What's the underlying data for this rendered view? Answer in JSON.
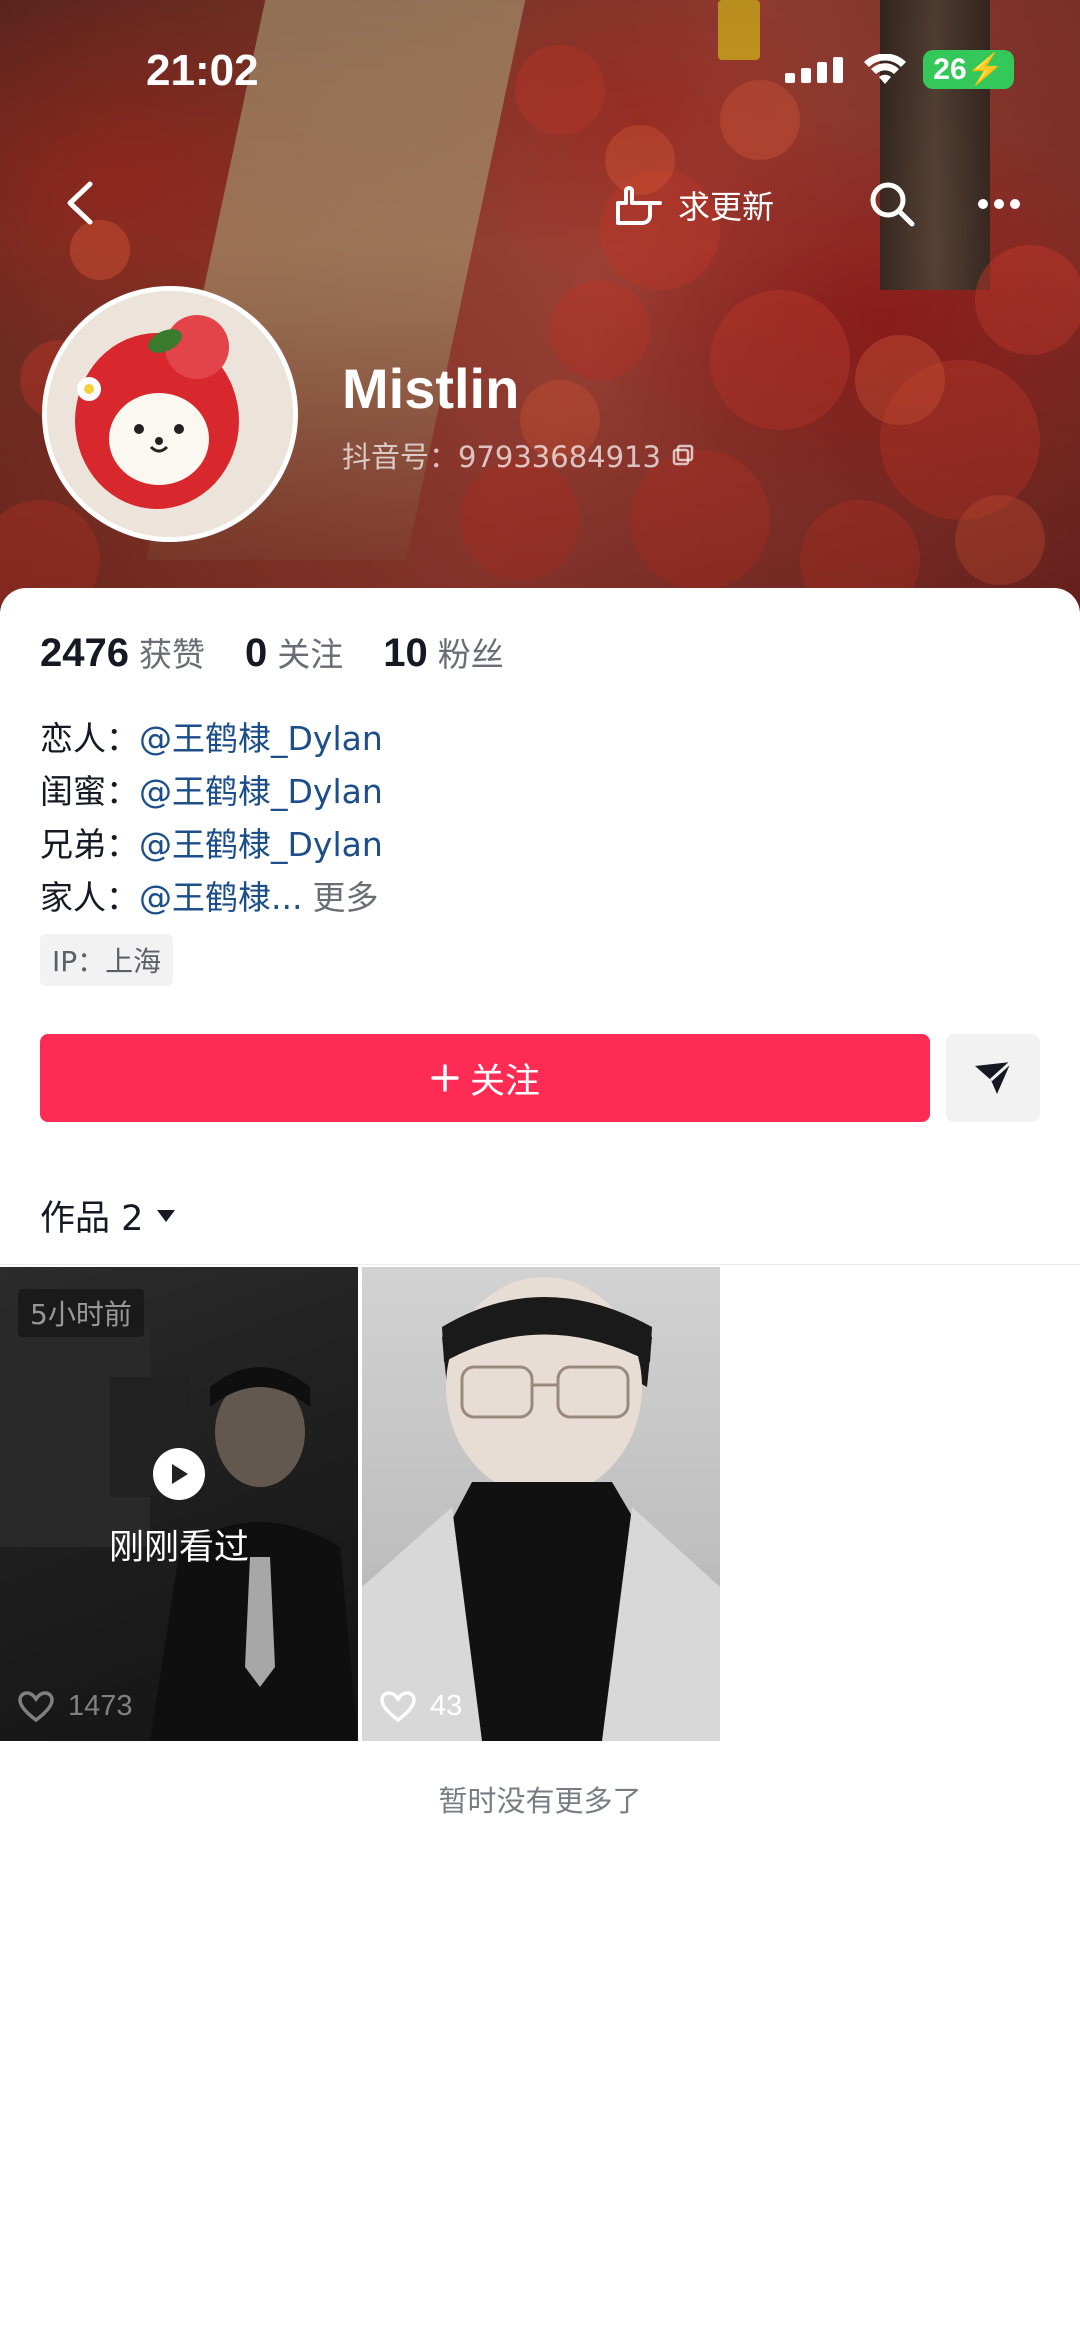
{
  "status_bar": {
    "time": "21:02",
    "battery": "26"
  },
  "nav": {
    "request_update_label": "求更新"
  },
  "profile": {
    "name": "Mistlin",
    "douyin_id": "抖音号：97933684913"
  },
  "stats": {
    "likes_count": "2476",
    "likes_label": "获赞",
    "following_count": "0",
    "following_label": "关注",
    "followers_count": "10",
    "followers_label": "粉丝"
  },
  "bio": {
    "lines": [
      {
        "label": "恋人：",
        "mention": "@王鹤棣_Dylan"
      },
      {
        "label": "闺蜜：",
        "mention": "@王鹤棣_Dylan"
      },
      {
        "label": "兄弟：",
        "mention": "@王鹤棣_Dylan"
      },
      {
        "label": "家人：",
        "mention": "@王鹤棣..."
      }
    ],
    "more_label": "更多",
    "ip": "IP：上海"
  },
  "actions": {
    "follow_label": "关注"
  },
  "works": {
    "tab_label": "作品 2",
    "videos": [
      {
        "time_badge": "5小时前",
        "watched_label": "刚刚看过",
        "likes": "1473"
      },
      {
        "likes": "43"
      }
    ],
    "no_more_label": "暂时没有更多了"
  },
  "colors": {
    "accent": "#fe2c55",
    "mention": "#1c4e8a"
  }
}
